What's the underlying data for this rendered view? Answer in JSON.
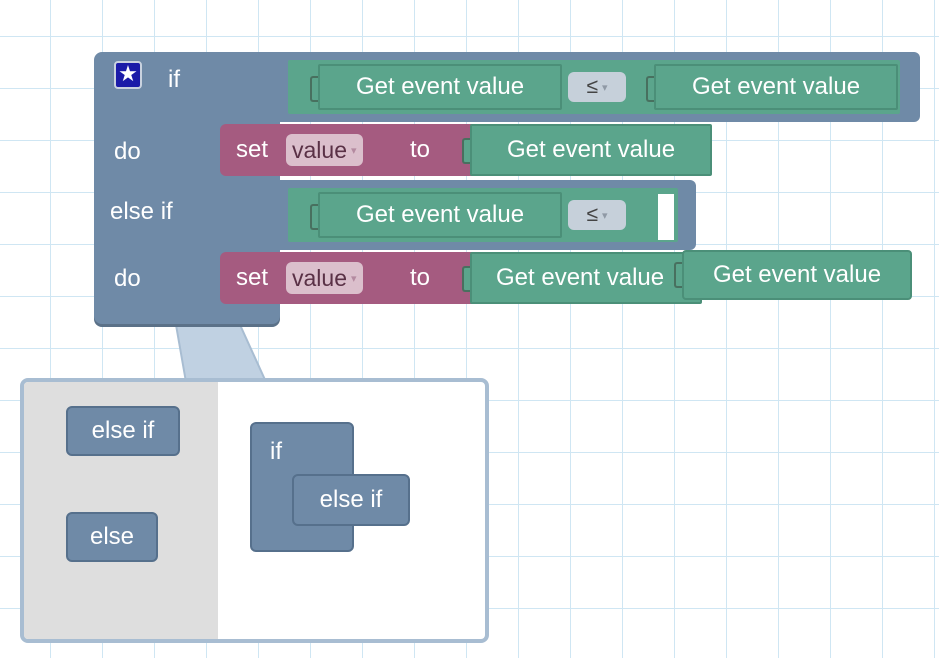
{
  "workspace": {
    "if_block": {
      "if_label": "if",
      "do_label_1": "do",
      "else_if_label": "else if",
      "do_label_2": "do",
      "mutator_icon": "star-gear-icon",
      "condition_1": {
        "left": "Get event value",
        "operator": "≤",
        "right": "Get event value"
      },
      "statement_1": {
        "set_label": "set",
        "variable": "value",
        "to_label": "to",
        "value": "Get event value"
      },
      "condition_2": {
        "left": "Get event value",
        "operator": "≤",
        "right": ""
      },
      "statement_2": {
        "set_label": "set",
        "variable": "value",
        "to_label": "to",
        "value": "Get event value"
      }
    },
    "loose_block": {
      "label": "Get event value"
    }
  },
  "mutator": {
    "flyout": {
      "else_if": "else if",
      "else": "else"
    },
    "editor": {
      "if_label": "if",
      "else_if": "else if"
    }
  },
  "colors": {
    "logic": "#6f8aa7",
    "text_value": "#5ba58c",
    "variable": "#a55b80",
    "bubble_border": "#a8bdd2"
  }
}
